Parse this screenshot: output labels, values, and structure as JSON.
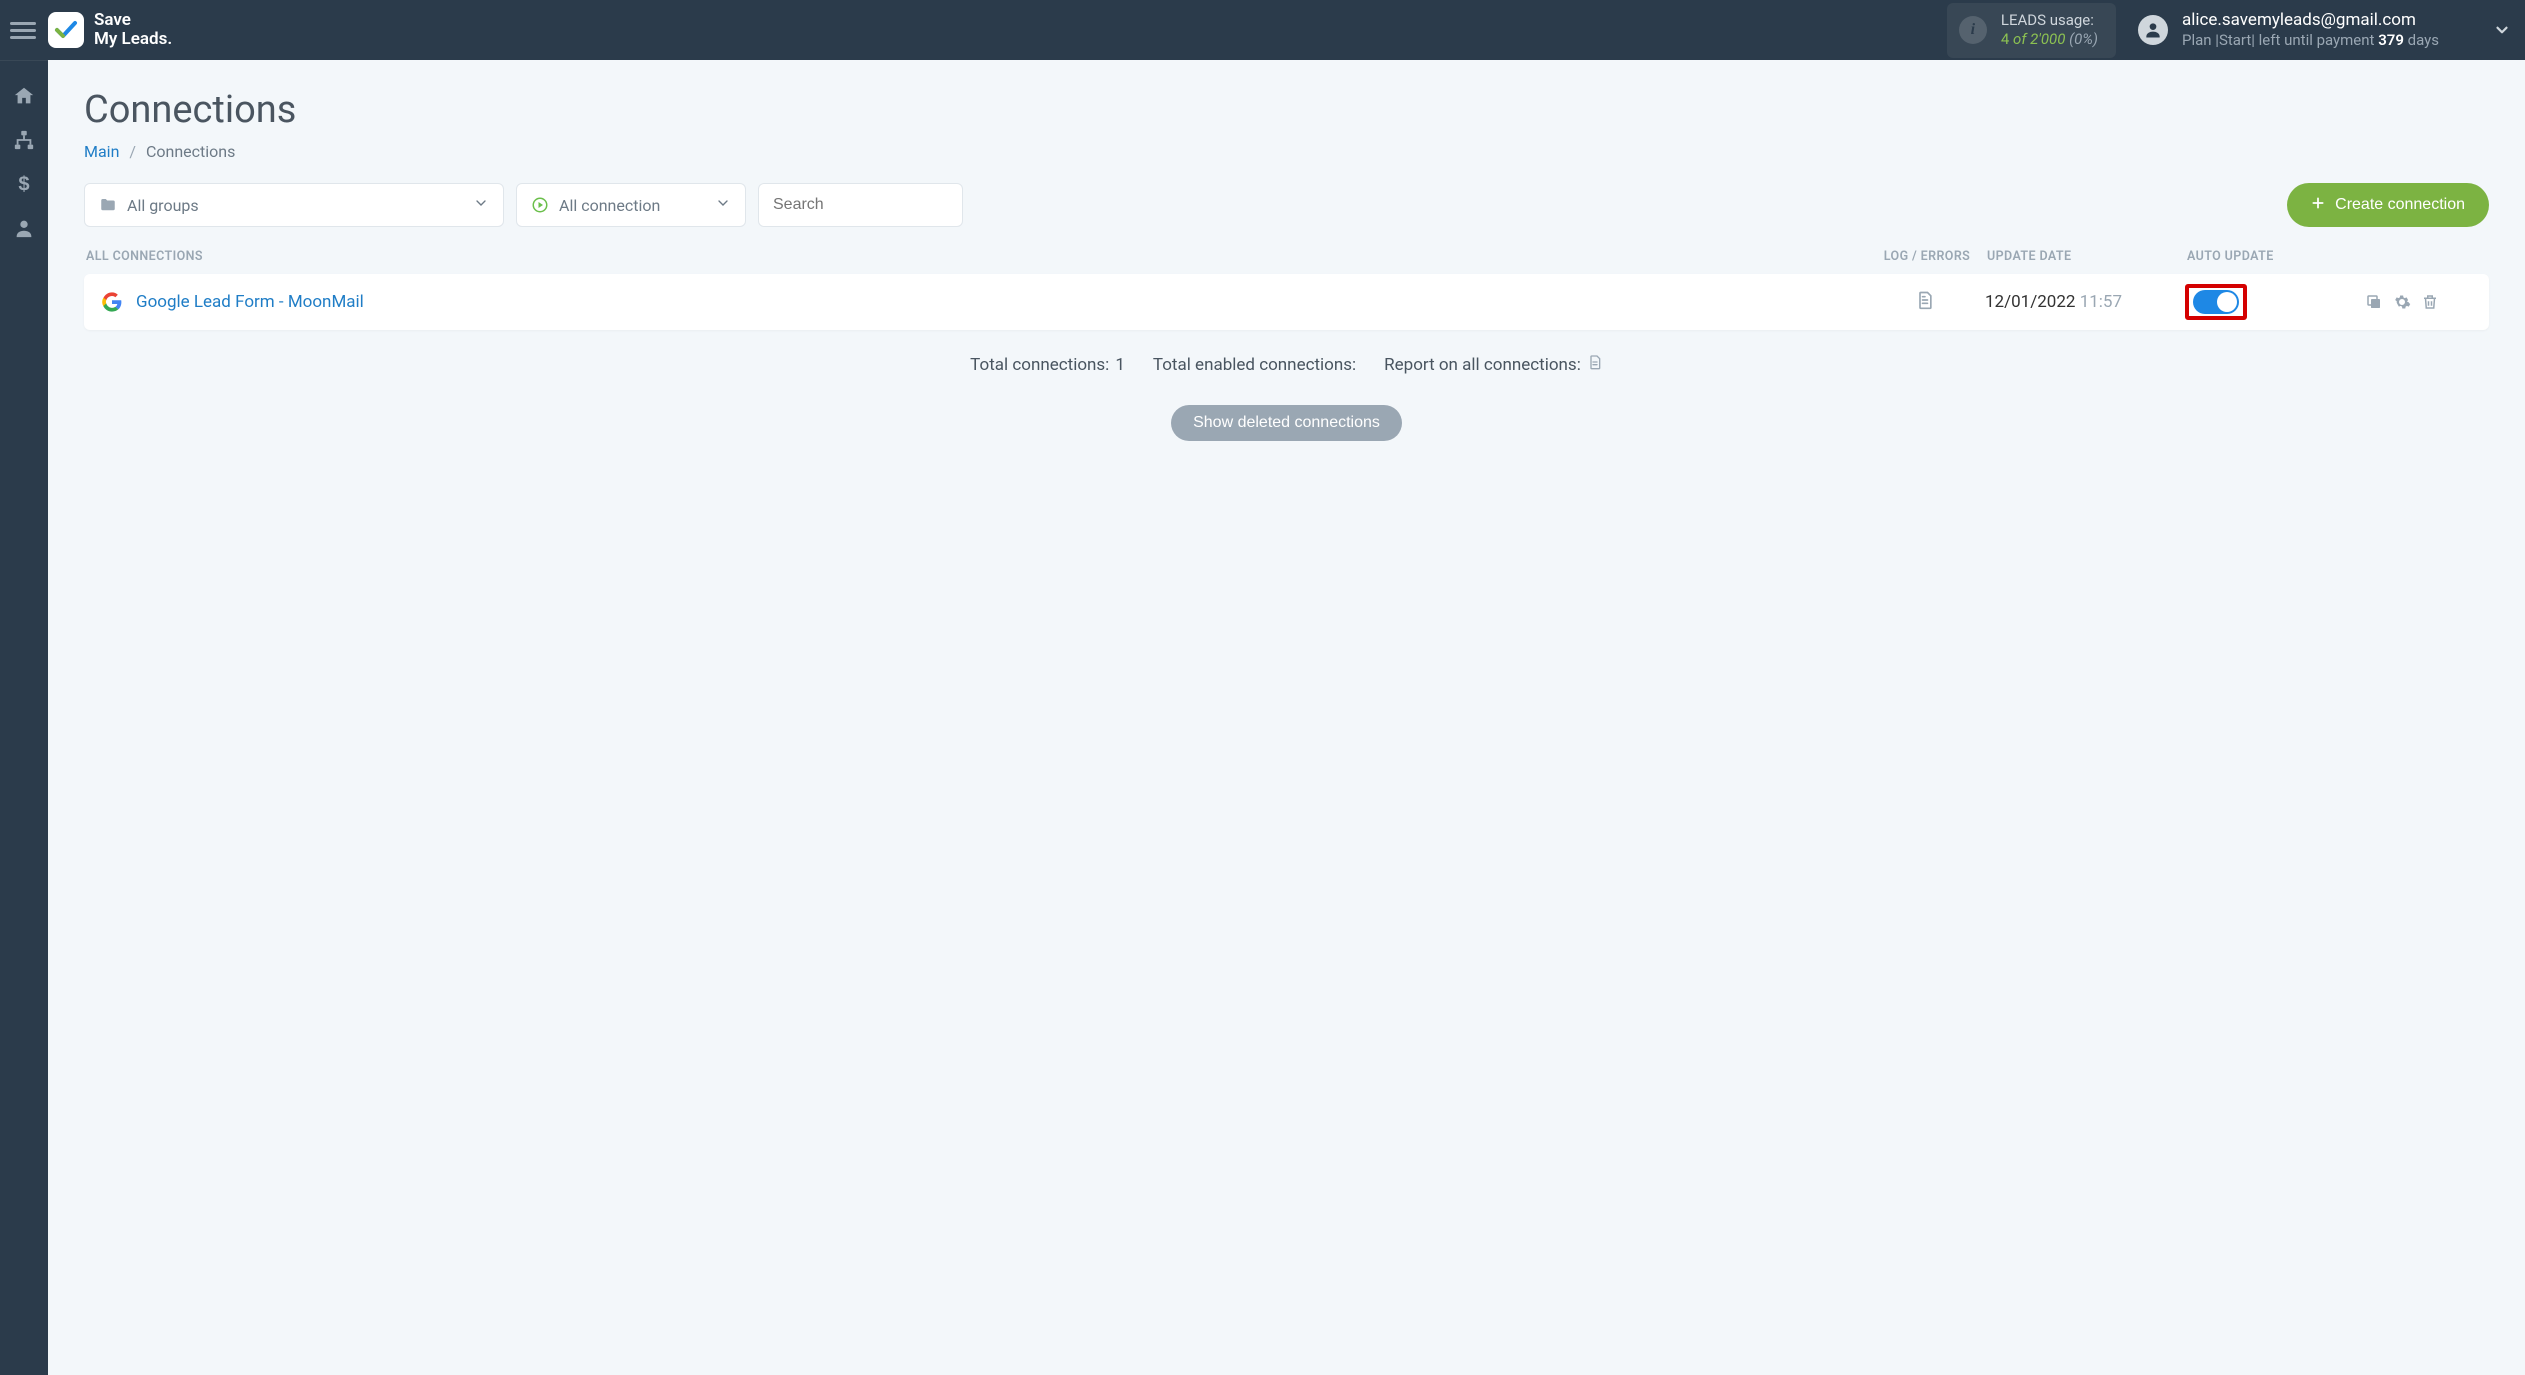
{
  "brand": {
    "line1": "Save",
    "line2": "My Leads."
  },
  "header": {
    "usage": {
      "label": "LEADS usage:",
      "used": "4",
      "of_word": "of",
      "limit": "2'000",
      "percent": "(0%)"
    },
    "account": {
      "email": "alice.savemyleads@gmail.com",
      "plan_prefix": "Plan |",
      "plan_name": "Start",
      "plan_suffix_left": "| left until payment",
      "plan_days": "379",
      "plan_suffix_right": "days"
    }
  },
  "page": {
    "title": "Connections",
    "breadcrumb_main": "Main",
    "breadcrumb_current": "Connections"
  },
  "filters": {
    "groups_label": "All groups",
    "connection_label": "All connection",
    "search_placeholder": "Search"
  },
  "buttons": {
    "create": "Create connection",
    "show_deleted": "Show deleted connections"
  },
  "columns": {
    "all": "ALL CONNECTIONS",
    "log": "LOG / ERRORS",
    "update": "UPDATE DATE",
    "auto": "AUTO UPDATE"
  },
  "rows": [
    {
      "name": "Google Lead Form - MoonMail",
      "date": "12/01/2022",
      "time": "11:57",
      "auto_update": true
    }
  ],
  "summary": {
    "total_label": "Total connections:",
    "total_value": "1",
    "enabled_label": "Total enabled connections:",
    "report_label": "Report on all connections:"
  }
}
